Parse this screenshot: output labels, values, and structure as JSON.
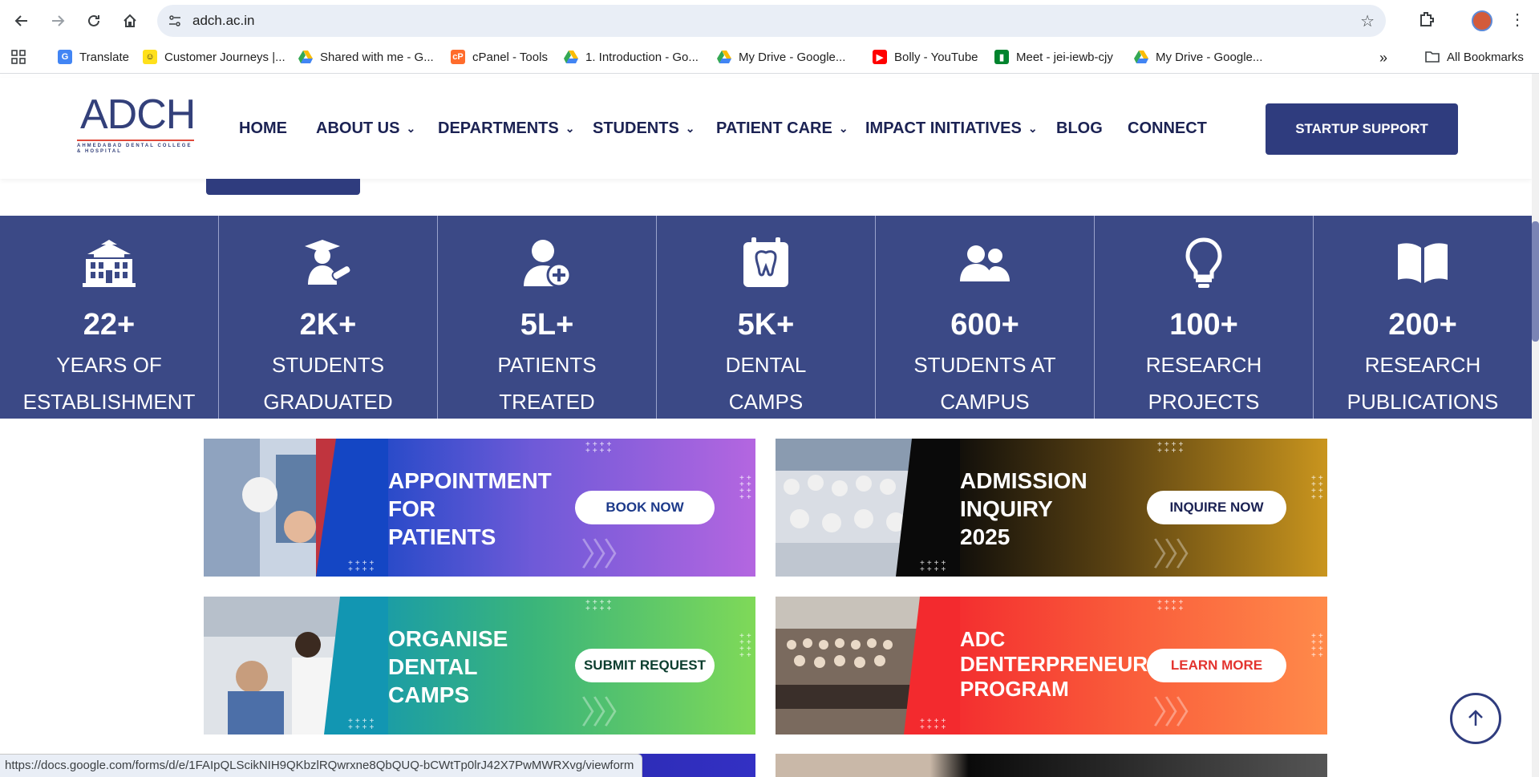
{
  "browser": {
    "url": "adch.ac.in",
    "bookmarks": [
      {
        "label": "Translate",
        "icon": "translate-icon",
        "color": "#4285f4"
      },
      {
        "label": "Customer Journeys |...",
        "icon": "mailchimp-icon",
        "color": "#ffe01b"
      },
      {
        "label": "Shared with me - G...",
        "icon": "google-drive-icon",
        "color": "#34a853"
      },
      {
        "label": "cPanel - Tools",
        "icon": "cpanel-icon",
        "color": "#ff6c2c"
      },
      {
        "label": "1. Introduction - Go...",
        "icon": "google-drive-icon",
        "color": "#34a853"
      },
      {
        "label": "My Drive - Google...",
        "icon": "google-drive-icon",
        "color": "#34a853"
      },
      {
        "label": "Bolly - YouTube",
        "icon": "youtube-icon",
        "color": "#ff0000"
      },
      {
        "label": "Meet - jei-iewb-cjy",
        "icon": "google-meet-icon",
        "color": "#00832d"
      },
      {
        "label": "My Drive - Google...",
        "icon": "google-drive-icon",
        "color": "#34a853"
      }
    ],
    "more_bookmarks": "»",
    "all_bookmarks": "All Bookmarks",
    "status_url": "https://docs.google.com/forms/d/e/1FAIpQLScikNIH9QKbzlRQwrxne8QbQUQ-bCWtTp0lrJ42X7PwMWRXvg/viewform"
  },
  "site": {
    "logo_text": "ADCH",
    "logo_subtext": "AHMEDABAD DENTAL COLLEGE & HOSPITAL",
    "brand_color": "#2f3c7e",
    "nav": [
      {
        "label": "HOME",
        "dropdown": false
      },
      {
        "label": "ABOUT US",
        "dropdown": true
      },
      {
        "label": "DEPARTMENTS",
        "dropdown": true
      },
      {
        "label": "STUDENTS",
        "dropdown": true
      },
      {
        "label": "PATIENT CARE",
        "dropdown": true
      },
      {
        "label": "IMPACT INITIATIVES",
        "dropdown": true
      },
      {
        "label": "BLOG",
        "dropdown": false
      },
      {
        "label": "CONNECT",
        "dropdown": false
      }
    ],
    "cta_label": "STARTUP SUPPORT"
  },
  "stats": [
    {
      "icon": "university-building-icon",
      "value": "22+",
      "label_line1": "YEARS OF",
      "label_line2": "ESTABLISHMENT"
    },
    {
      "icon": "graduate-icon",
      "value": "2K+",
      "label_line1": "STUDENTS",
      "label_line2": "GRADUATED"
    },
    {
      "icon": "patient-plus-icon",
      "value": "5L+",
      "label_line1": "PATIENTS",
      "label_line2": "TREATED"
    },
    {
      "icon": "tooth-calendar-icon",
      "value": "5K+",
      "label_line1": "DENTAL",
      "label_line2": "CAMPS"
    },
    {
      "icon": "users-icon",
      "value": "600+",
      "label_line1": "STUDENTS AT",
      "label_line2": "CAMPUS"
    },
    {
      "icon": "lightbulb-icon",
      "value": "100+",
      "label_line1": "RESEARCH",
      "label_line2": "PROJECTS"
    },
    {
      "icon": "book-open-icon",
      "value": "200+",
      "label_line1": "RESEARCH",
      "label_line2": "PUBLICATIONS"
    }
  ],
  "banners": [
    {
      "title_lines": [
        "APPOINTMENT",
        "FOR",
        "PATIENTS"
      ],
      "button": "BOOK NOW",
      "button_color": "#1d3a8a",
      "gradient": [
        "#1446c4",
        "#b466e0"
      ]
    },
    {
      "title_lines": [
        "ADMISSION",
        "INQUIRY",
        "2025"
      ],
      "button": "INQUIRE NOW",
      "button_color": "#1b2253",
      "gradient": [
        "#0a0a0a",
        "#c9951e"
      ]
    },
    {
      "title_lines": [
        "ORGANISE",
        "DENTAL",
        "CAMPS"
      ],
      "button": "SUBMIT REQUEST",
      "button_color": "#0b3d2e",
      "gradient": [
        "#1296b2",
        "#7fd958"
      ]
    },
    {
      "title_lines": [
        "ADC",
        "DENTERPRENEUR",
        "PROGRAM"
      ],
      "button": "LEARN MORE",
      "button_color": "#e3342f",
      "gradient": [
        "#f32a2e",
        "#ff8a4a"
      ]
    }
  ]
}
